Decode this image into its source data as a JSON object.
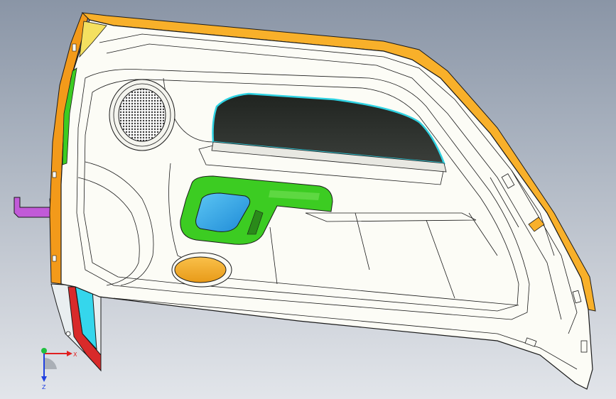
{
  "viewport": {
    "background_top": "#8a95a6",
    "background_bottom": "#e2e5ea"
  },
  "model": {
    "part": "door trim panel",
    "colors": {
      "panel_body": "#fcfcf6",
      "top_edge_strip": "#f8b02a",
      "left_edge_strip": "#f39a1a",
      "window_pocket": "#2a2e2a",
      "window_seal": "#2fd2e2",
      "handle_bezel": "#3ccc22",
      "handle_cup": "#2aa6ea",
      "lower_cap": "#f7b12e",
      "speaker_grille": "#3a3a3a",
      "bracket": "#c15ad8",
      "lower_strip_cyan": "#35d6ec",
      "lower_strip_red": "#d82a2a",
      "outline": "#1a1a1a"
    }
  },
  "triad": {
    "x_label": "X",
    "z_label": "Z",
    "x_color": "#e02020",
    "y_color": "#20c040",
    "z_color": "#2040e0"
  }
}
